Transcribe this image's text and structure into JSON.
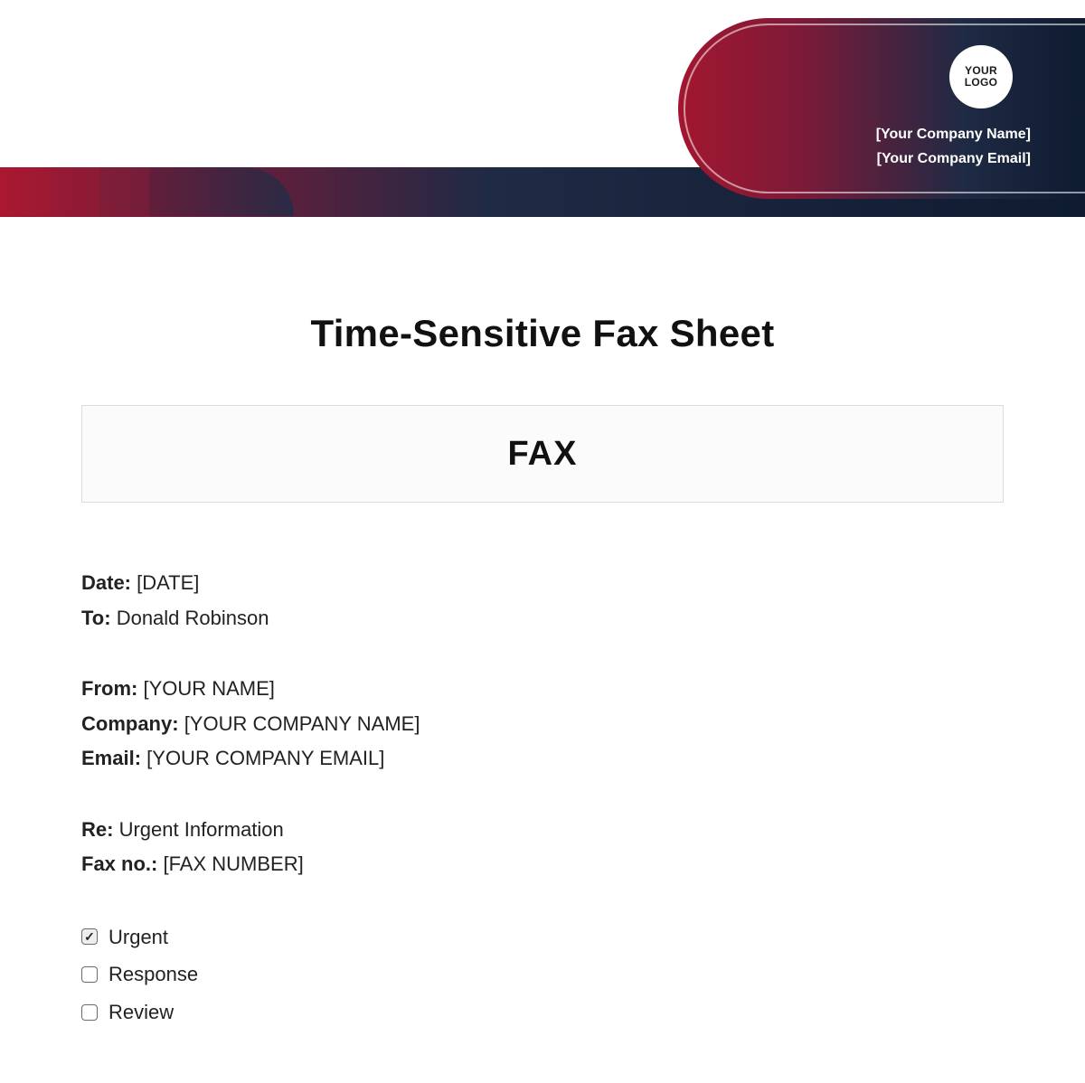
{
  "header": {
    "logo_line1": "YOUR",
    "logo_line2": "LOGO",
    "company_name": "[Your Company Name]",
    "company_email": "[Your Company Email]"
  },
  "title": "Time-Sensitive Fax Sheet",
  "fax_box": "FAX",
  "fields": {
    "date_label": "Date:",
    "date_value": "[DATE]",
    "to_label": "To:",
    "to_value": "Donald Robinson",
    "from_label": "From:",
    "from_value": "[YOUR NAME]",
    "company_label": "Company:",
    "company_value": "[YOUR COMPANY NAME]",
    "email_label": "Email:",
    "email_value": "[YOUR COMPANY EMAIL]",
    "re_label": "Re:",
    "re_value": "Urgent Information",
    "faxno_label": "Fax no.:",
    "faxno_value": "[FAX NUMBER]"
  },
  "checks": [
    {
      "label": "Urgent",
      "checked": true
    },
    {
      "label": "Response",
      "checked": false
    },
    {
      "label": "Review",
      "checked": false
    }
  ]
}
